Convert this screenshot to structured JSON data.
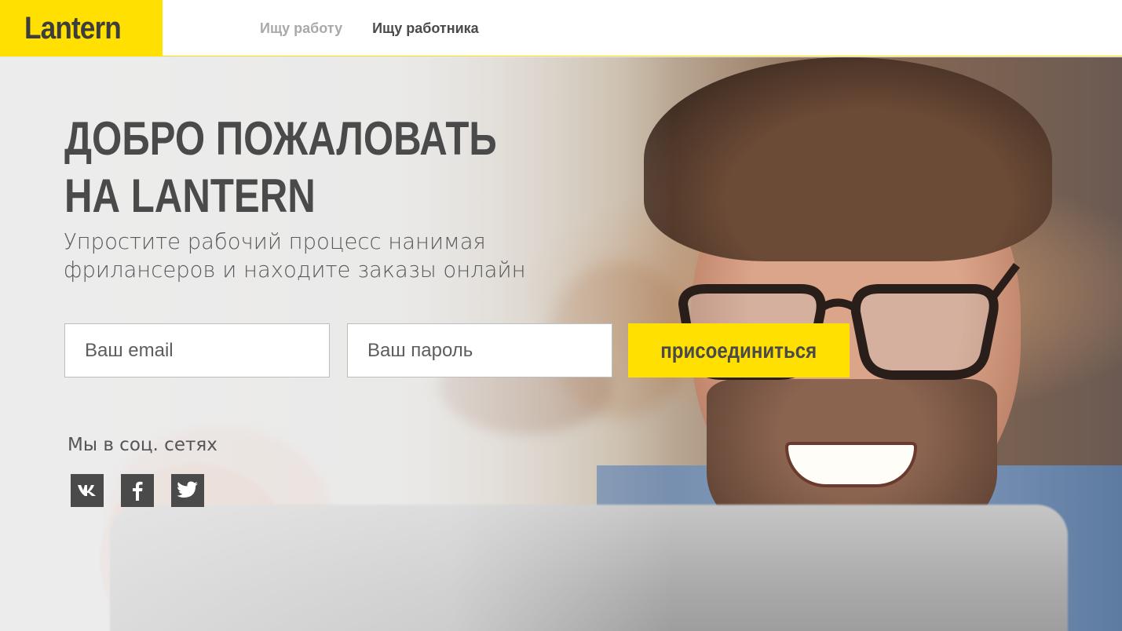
{
  "header": {
    "logo": "Lantern",
    "nav": [
      {
        "label": "Ищу работу",
        "state": "inactive"
      },
      {
        "label": "Ищу работника",
        "state": "active"
      }
    ]
  },
  "hero": {
    "title_line1": "ДОБРО ПОЖАЛОВАТЬ",
    "title_line2": "НА LANTERN",
    "subtitle_line1": "Упростите рабочий процесс нанимая",
    "subtitle_line2": "фрилансеров и находите заказы онлайн",
    "form": {
      "email_placeholder": "Ваш email",
      "password_placeholder": "Ваш пароль",
      "join_label": "присоединиться"
    },
    "social": {
      "label": "Мы в соц. сетях",
      "icons": [
        "vk-icon",
        "facebook-icon",
        "twitter-icon"
      ]
    }
  },
  "colors": {
    "brand_yellow": "#ffe000",
    "text_dark": "#4a4a4a",
    "nav_inactive": "#a9a9a9"
  }
}
